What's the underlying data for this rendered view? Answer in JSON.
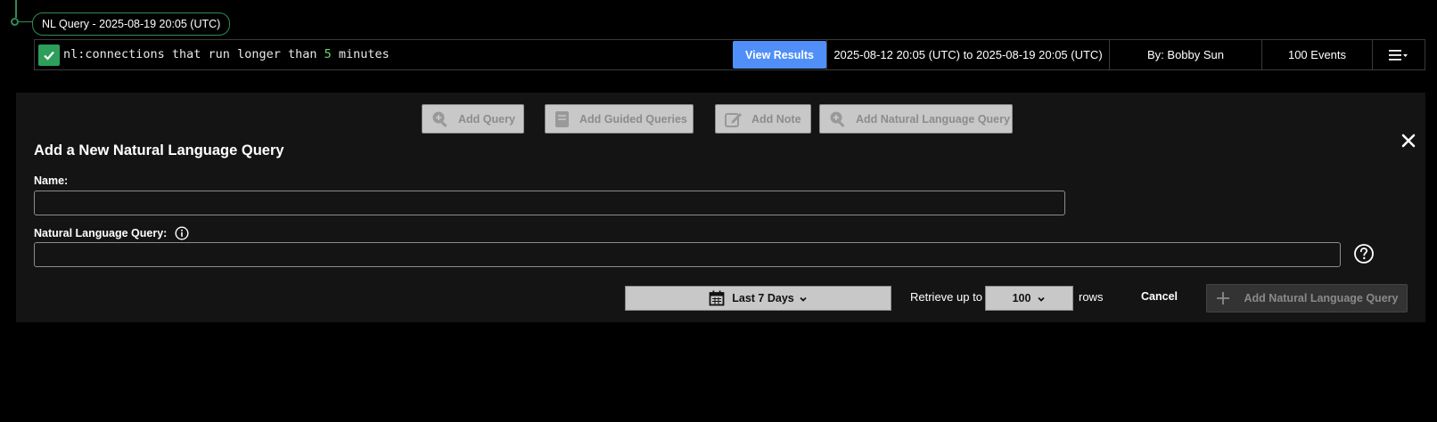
{
  "query_chip": {
    "label": "NL Query - 2025-08-19 20:05 (UTC)"
  },
  "query_row": {
    "status_icon": "checkmark-icon",
    "query_prefix": "nl:connections that run longer than ",
    "query_number": "5",
    "query_suffix": " minutes",
    "view_results_label": "View Results",
    "date_range": "2025-08-12 20:05 (UTC) to 2025-08-19 20:05 (UTC)",
    "author": "By: Bobby Sun",
    "events": "100 Events",
    "menu_icon": "hamburger-menu-icon"
  },
  "toolbar": {
    "add_query": "Add Query",
    "add_guided_queries": "Add Guided Queries",
    "add_note": "Add Note",
    "add_nl_query": "Add Natural Language Query"
  },
  "form": {
    "title": "Add a New Natural Language Query",
    "name_label": "Name:",
    "name_value": "",
    "nlq_label": "Natural Language Query:",
    "nlq_value": "",
    "time_range": "Last 7 Days",
    "retrieve_label": "Retrieve up to",
    "rows_value": "100",
    "rows_label": "rows",
    "cancel_label": "Cancel",
    "submit_label": "Add Natural Language Query"
  },
  "colors": {
    "accent_green": "#2e8b57",
    "view_button_blue": "#4f8ff7",
    "panel_bg": "#141414"
  }
}
